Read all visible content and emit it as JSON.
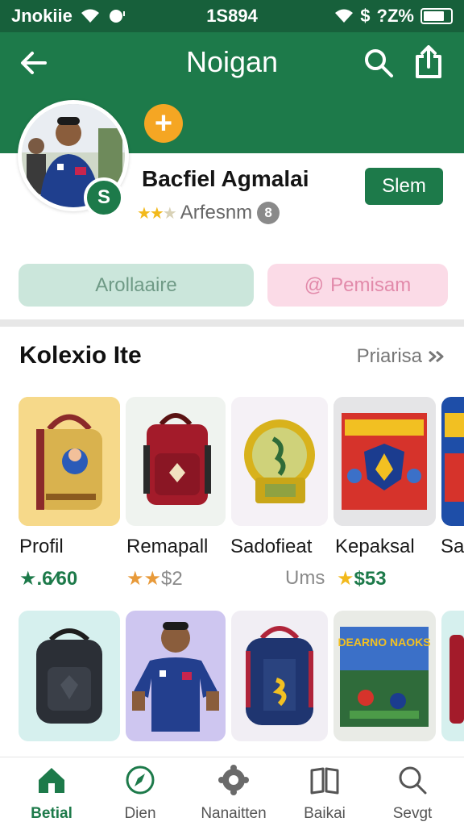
{
  "status_bar": {
    "carrier": "Jnokiie",
    "time": "1S894",
    "battery": "?Z%"
  },
  "header": {
    "title": "Noigan"
  },
  "profile": {
    "name": "Bacfiel Agmalai",
    "handle": "Arfesnm",
    "avatar_badge": "S",
    "follow_label": "Slem",
    "rating_stars": "★★★",
    "info_symbol": "8"
  },
  "actions": {
    "primary_label": "Arollaaire",
    "secondary_label": "Pemisam",
    "secondary_symbol": "@"
  },
  "collection": {
    "title": "Kolexio Ite",
    "see_all": "Priarisa",
    "row1": [
      {
        "label": "Profil",
        "meta": ".6∕60",
        "meta_prefix": "★",
        "meta_color": "#1d7a4a"
      },
      {
        "label": "Remapall",
        "meta": "$2",
        "meta_prefix": "★★",
        "meta_color": "#8a8a8a"
      },
      {
        "label": "Sadofieat",
        "meta": "Ums",
        "meta_prefix": "",
        "meta_color": "#8a8a8a"
      },
      {
        "label": "Kepaksal",
        "meta": "$53",
        "meta_prefix": "★",
        "meta_color": "#1d7a4a"
      },
      {
        "label": "Sap",
        "meta": "",
        "meta_prefix": "",
        "meta_color": "#1d7a4a"
      }
    ],
    "row2_names": [
      "Backpack",
      "Jersey",
      "Backpack",
      "Game box",
      "Backpack"
    ],
    "box_text": "DEARNO NAOKS"
  },
  "tabs": [
    {
      "label": "Betial",
      "icon": "home-icon",
      "active": true
    },
    {
      "label": "Dien",
      "icon": "compass-icon",
      "active": false
    },
    {
      "label": "Nanaitten",
      "icon": "settings-icon",
      "active": false
    },
    {
      "label": "Baikai",
      "icon": "book-icon",
      "active": false
    },
    {
      "label": "Sevgt",
      "icon": "search-icon",
      "active": false
    }
  ],
  "colors": {
    "brand_green": "#1d7a4a",
    "accent_orange": "#f5a623",
    "pill_green": "#cbe6db",
    "pill_pink": "#fbdbe7"
  }
}
